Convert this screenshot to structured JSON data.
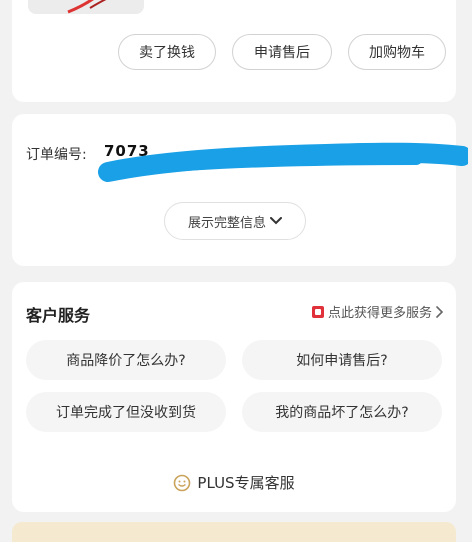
{
  "actions": {
    "sell_label": "卖了换钱",
    "aftersale_label": "申请售后",
    "cart_label": "加购物车"
  },
  "order": {
    "label": "订单编号:",
    "number_visible": "7073",
    "expand_label": "展示完整信息"
  },
  "service": {
    "title": "客户服务",
    "more_label": "点此获得更多服务",
    "questions": [
      "商品降价了怎么办?",
      "如何申请售后?",
      "订单完成了但没收到货",
      "我的商品坏了怎么办?"
    ],
    "plus_label": "PLUS专属客服"
  },
  "colors": {
    "redaction": "#1aa0e6",
    "accent_red": "#e0303a",
    "plus_gold": "#c9a35a"
  }
}
